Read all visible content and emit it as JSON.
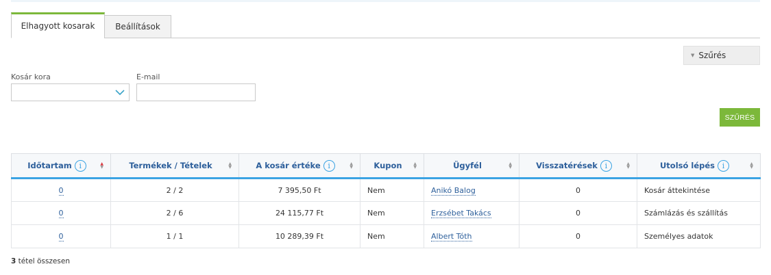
{
  "tabs": [
    {
      "label": "Elhagyott kosarak",
      "active": true
    },
    {
      "label": "Beállítások",
      "active": false
    }
  ],
  "filter": {
    "toggle_label": "Szűrés",
    "cart_age_label": "Kosár kora",
    "email_label": "E-mail",
    "email_value": "",
    "submit_label": "SZŰRÉS"
  },
  "table": {
    "columns": [
      {
        "label": "Időtartam",
        "info": true
      },
      {
        "label": "Termékek / Tételek",
        "info": false
      },
      {
        "label": "A kosár értéke",
        "info": true
      },
      {
        "label": "Kupon",
        "info": false
      },
      {
        "label": "Ügyfél",
        "info": false
      },
      {
        "label": "Visszatérések",
        "info": true
      },
      {
        "label": "Utolsó lépés",
        "info": true
      }
    ],
    "rows": [
      {
        "duration": "0",
        "items": "2 / 2",
        "value": "7 395,50 Ft",
        "coupon": "Nem",
        "customer": "Anikó Balog",
        "returns": "0",
        "last_step": "Kosár áttekintése"
      },
      {
        "duration": "0",
        "items": "2 / 6",
        "value": "24 115,77 Ft",
        "coupon": "Nem",
        "customer": "Erzsébet Takács",
        "returns": "0",
        "last_step": "Számlázás és szállítás"
      },
      {
        "duration": "0",
        "items": "1 / 1",
        "value": "10 289,39 Ft",
        "coupon": "Nem",
        "customer": "Albert Tóth",
        "returns": "0",
        "last_step": "Személyes adatok"
      }
    ]
  },
  "summary": {
    "count": "3",
    "suffix": " tétel összesen"
  },
  "icons": {
    "info": "info-icon",
    "chevron": "chevron-down-icon",
    "sort": "sort-icon",
    "caret": "caret-down-icon"
  },
  "colors": {
    "accent_green": "#7cb83a",
    "header_blue": "#2d5f9b",
    "underline_blue": "#3aa3e3",
    "sort_active": "#d9363e"
  }
}
